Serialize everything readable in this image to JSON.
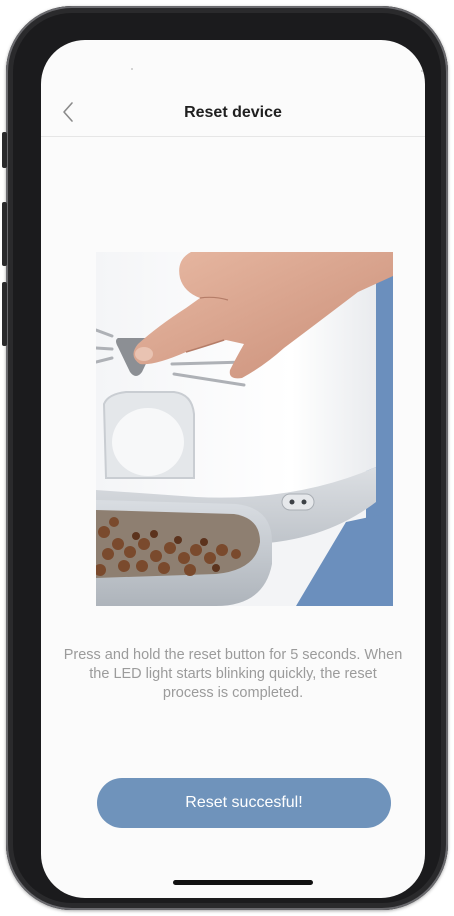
{
  "header": {
    "title": "Reset device"
  },
  "icons": {
    "back": "chevron-left-icon"
  },
  "illustration": {
    "subject": "hand-pressing-reset-button-on-pet-feeder"
  },
  "instructions": {
    "text": "Press and hold the reset button for 5 seconds. When the LED light starts blinking quickly, the reset process is completed."
  },
  "primary_button": {
    "label": "Reset succesful!"
  },
  "colors": {
    "accent": "#6f93bb",
    "title_text": "#1f1f1f",
    "body_text": "#9b9b9b",
    "screen_bg": "#fbfbfb",
    "photo_bg": "#6b8fbd"
  }
}
